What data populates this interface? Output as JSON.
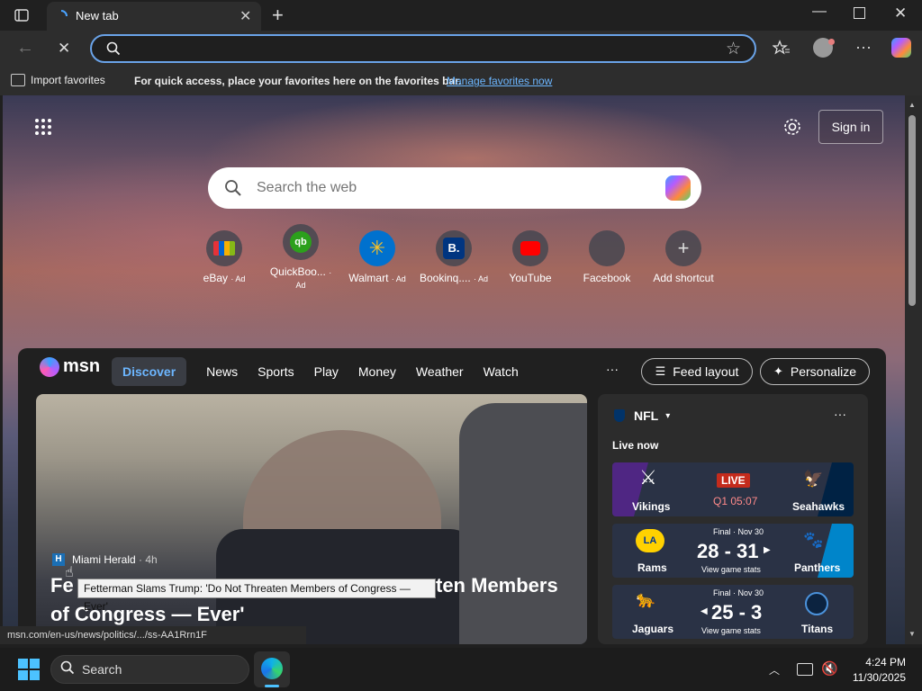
{
  "browser": {
    "tab_title": "New tab",
    "omnibox_value": "",
    "favbar": {
      "import_label": "Import favorites",
      "message": "For quick access, place your favorites here on the favorites bar.",
      "manage_link": "Manage favorites now"
    }
  },
  "page": {
    "signin_label": "Sign in",
    "search_placeholder": "Search the web",
    "shortcuts": [
      {
        "label": "eBay",
        "ad": "· Ad",
        "icon": "ebay-icon",
        "color": "#e53238"
      },
      {
        "label": "QuickBoo...",
        "ad": "· Ad",
        "icon": "quickbooks-icon",
        "color": "#2ca01c"
      },
      {
        "label": "Walmart",
        "ad": "· Ad",
        "icon": "walmart-icon",
        "color": "#ffc220"
      },
      {
        "label": "Bookinq....",
        "ad": "· Ad",
        "icon": "booking-icon",
        "color": "#003580"
      },
      {
        "label": "YouTube",
        "ad": "",
        "icon": "youtube-icon",
        "color": "#ff0000"
      },
      {
        "label": "Facebook",
        "ad": "",
        "icon": "facebook-icon",
        "color": "#555555"
      },
      {
        "label": "Add shortcut",
        "ad": "",
        "icon": "plus-icon",
        "color": "#555555"
      }
    ]
  },
  "feed": {
    "logo": "msn",
    "nav": [
      "Discover",
      "News",
      "Sports",
      "Play",
      "Money",
      "Weather",
      "Watch"
    ],
    "more": "···",
    "feed_layout_label": "Feed layout",
    "personalize_label": "Personalize",
    "hero": {
      "source": "Miami Herald",
      "age": "· 4h",
      "headline_line1": "Fe",
      "headline_line1_tail": "ten Members",
      "headline_line2": "of Congress — Ever'"
    },
    "tooltip": "Fetterman Slams Trump: 'Do Not Threaten Members of Congress — Ever'",
    "status_url": "msn.com/en-us/news/politics/.../ss-AA1Rrn1F"
  },
  "nfl": {
    "title": "NFL",
    "more": "···",
    "live_now": "Live now",
    "games": [
      {
        "home": "Vikings",
        "away": "Seahawks",
        "status": "LIVE",
        "detail": "Q1 05:07",
        "score": "",
        "stats": "",
        "colorL": "#4f2683",
        "colorR": "#002244"
      },
      {
        "home": "Rams",
        "away": "Panthers",
        "status": "",
        "detail": "Final · Nov 30",
        "score": "28 - 31",
        "stats": "View game stats",
        "colorL": "#003594",
        "colorR": "#0085ca"
      },
      {
        "home": "Jaguars",
        "away": "Titans",
        "status": "",
        "detail": "Final · Nov 30",
        "score": "25 - 3",
        "stats": "View game stats",
        "colorL": "#006778",
        "colorR": "#0c2340"
      }
    ]
  },
  "taskbar": {
    "search_label": "Search",
    "time": "4:24 PM",
    "date": "11/30/2025"
  }
}
